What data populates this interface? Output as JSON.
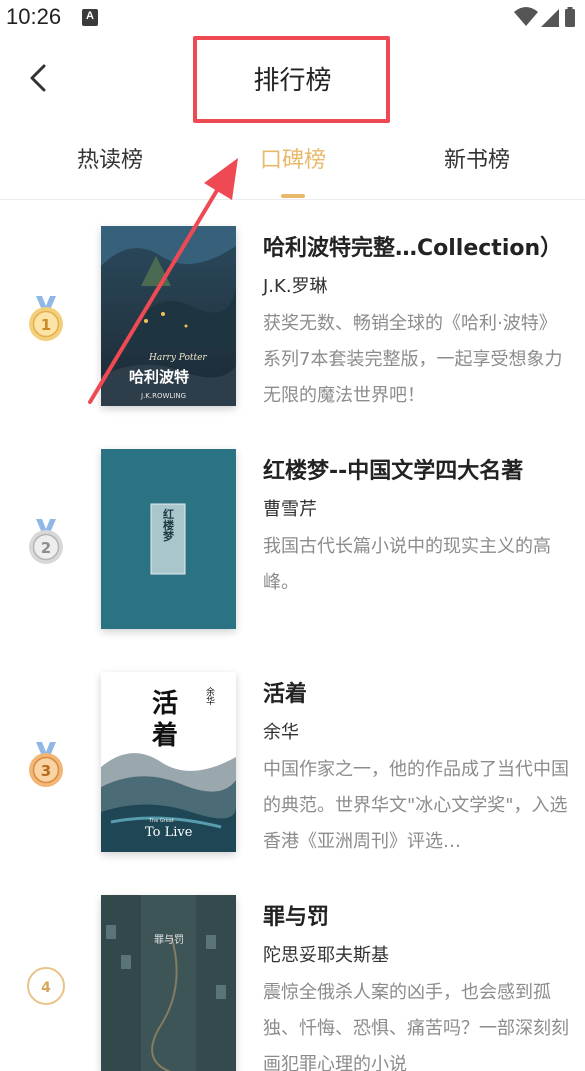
{
  "status": {
    "time": "10:26",
    "notification_badge": "A"
  },
  "header": {
    "title": "排行榜",
    "back_icon": "chevron-left-icon"
  },
  "tabs": [
    {
      "label": "热读榜",
      "active": false
    },
    {
      "label": "口碑榜",
      "active": true
    },
    {
      "label": "新书榜",
      "active": false
    }
  ],
  "accent_color": "#e8b96a",
  "annotation_color": "#ef4a53",
  "books": [
    {
      "rank": "1",
      "title": "哈利波特完整…Collection）",
      "author": "J.K.罗琳",
      "description": "获奖无数、畅销全球的《哈利·波特》系列7本套装完整版，一起享受想象力无限的魔法世界吧！",
      "cover": {
        "line1": "Harry Potter",
        "line2": "哈利波特",
        "line3": "J.K.ROWLING"
      }
    },
    {
      "rank": "2",
      "title": "红楼梦--中国文学四大名著",
      "author": "曹雪芹",
      "description": "我国古代长篇小说中的现实主义的高峰。",
      "cover": {
        "label": "红楼梦"
      }
    },
    {
      "rank": "3",
      "title": "活着",
      "author": "余华",
      "description": "中国作家之一，他的作品成了当代中国的典范。世界华文\"冰心文学奖\"，入选香港《亚洲周刊》评选…",
      "cover": {
        "title_char_1": "活",
        "title_char_2": "着",
        "author": "余华",
        "subtitle_small": "The Great",
        "subtitle": "To Live"
      }
    },
    {
      "rank": "4",
      "title": "罪与罚",
      "author": "陀思妥耶夫斯基",
      "description": "震惊全俄杀人案的凶手，也会感到孤独、忏悔、恐惧、痛苦吗？一部深刻刻画犯罪心理的小说",
      "cover": {
        "label": "罪与罚"
      }
    }
  ]
}
